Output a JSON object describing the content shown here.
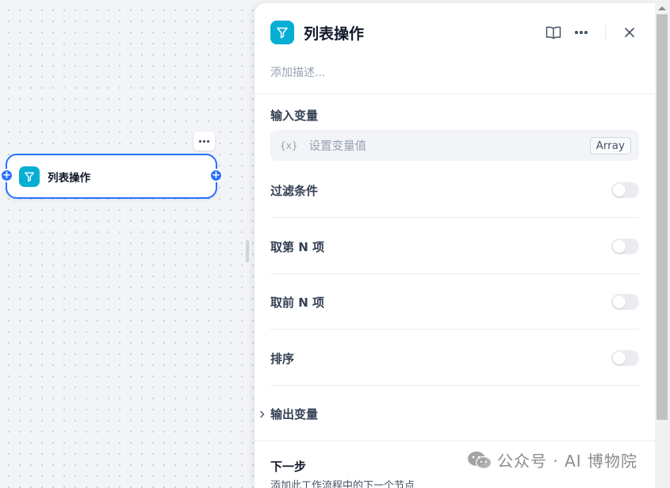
{
  "canvas": {
    "node": {
      "title": "列表操作",
      "icon": "filter-icon",
      "accent_color": "#2970ff",
      "icon_bg": "#06aed4"
    },
    "handle_glyph": "+"
  },
  "panel": {
    "title": "列表操作",
    "icon": "filter-icon",
    "description_placeholder": "添加描述...",
    "actions": [
      "book-icon",
      "more-icon",
      "close-icon"
    ],
    "input_section": {
      "label": "输入变量",
      "braces": "{x}",
      "placeholder": "设置变量值",
      "type_tag": "Array"
    },
    "toggles": [
      {
        "label": "过滤条件",
        "on": false
      },
      {
        "label": "取第 N 项",
        "on": false
      },
      {
        "label": "取前 N 项",
        "on": false
      },
      {
        "label": "排序",
        "on": false
      }
    ],
    "output_section": {
      "label": "输出变量"
    },
    "next_step": {
      "title": "下一步",
      "description": "添加此工作流程中的下一个节点"
    }
  },
  "watermark": {
    "text": "公众号 · AI 博物院",
    "icon": "wechat-icon"
  }
}
